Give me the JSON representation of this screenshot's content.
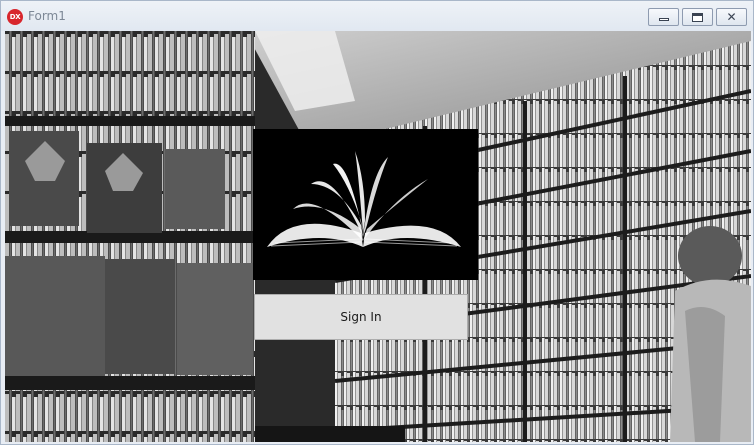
{
  "window": {
    "title": "Form1",
    "app_icon_label": "DX",
    "minimize_glyph": "",
    "maximize_glyph": "",
    "close_glyph": "✕"
  },
  "login": {
    "sign_in_label": "Sign In"
  },
  "background": {
    "description_icon": "bookstore-photo",
    "logo_icon": "open-book-icon"
  },
  "colors": {
    "titlebar": "#e6ecf4",
    "app_icon": "#d8262c",
    "logo_panel": "#000000",
    "button": "#e1e1e1"
  }
}
